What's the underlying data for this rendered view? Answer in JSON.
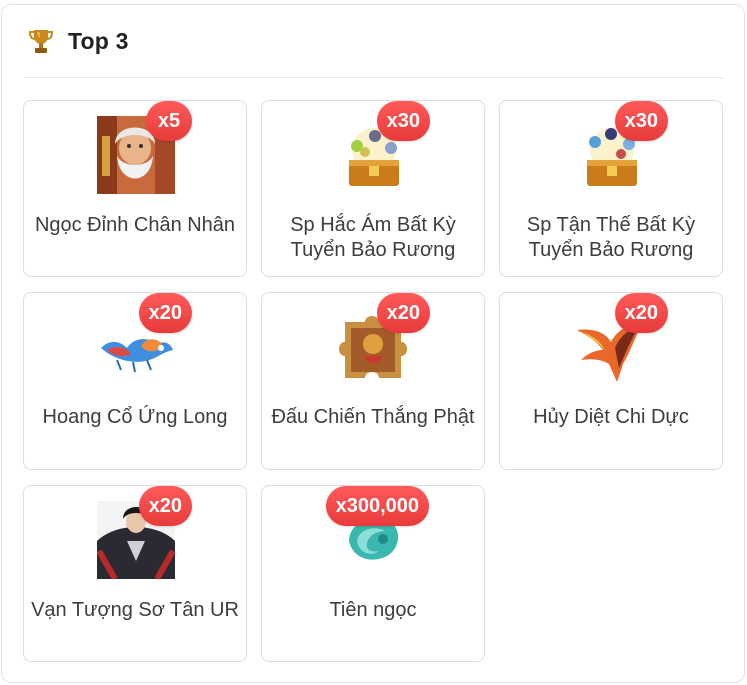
{
  "header": {
    "title": "Top 3",
    "icon": "trophy-icon"
  },
  "colors": {
    "badge": "#f04848",
    "trophy": "#c8881e"
  },
  "items": [
    {
      "name": "Ngọc Đỉnh Chân Nhân",
      "qty": "x5",
      "icon": "old-sage-portrait"
    },
    {
      "name": "Sp Hắc Ám Bất Kỳ Tuyển Bảo Rương",
      "qty": "x30",
      "icon": "treasure-chest-dark"
    },
    {
      "name": "Sp Tận Thế Bất Kỳ Tuyển Bảo Rương",
      "qty": "x30",
      "icon": "treasure-chest-apocalypse"
    },
    {
      "name": "Hoang Cổ Ứng Long",
      "qty": "x20",
      "icon": "winged-dragon"
    },
    {
      "name": "Đấu Chiến Thắng Phật",
      "qty": "x20",
      "icon": "puzzle-fragment"
    },
    {
      "name": "Hủy Diệt Chi Dực",
      "qty": "x20",
      "icon": "fire-wings"
    },
    {
      "name": "Vạn Tượng Sơ Tân UR",
      "qty": "x20",
      "icon": "dark-warrior-portrait"
    },
    {
      "name": "Tiên ngọc",
      "qty": "x300,000",
      "icon": "jade-gem"
    }
  ]
}
